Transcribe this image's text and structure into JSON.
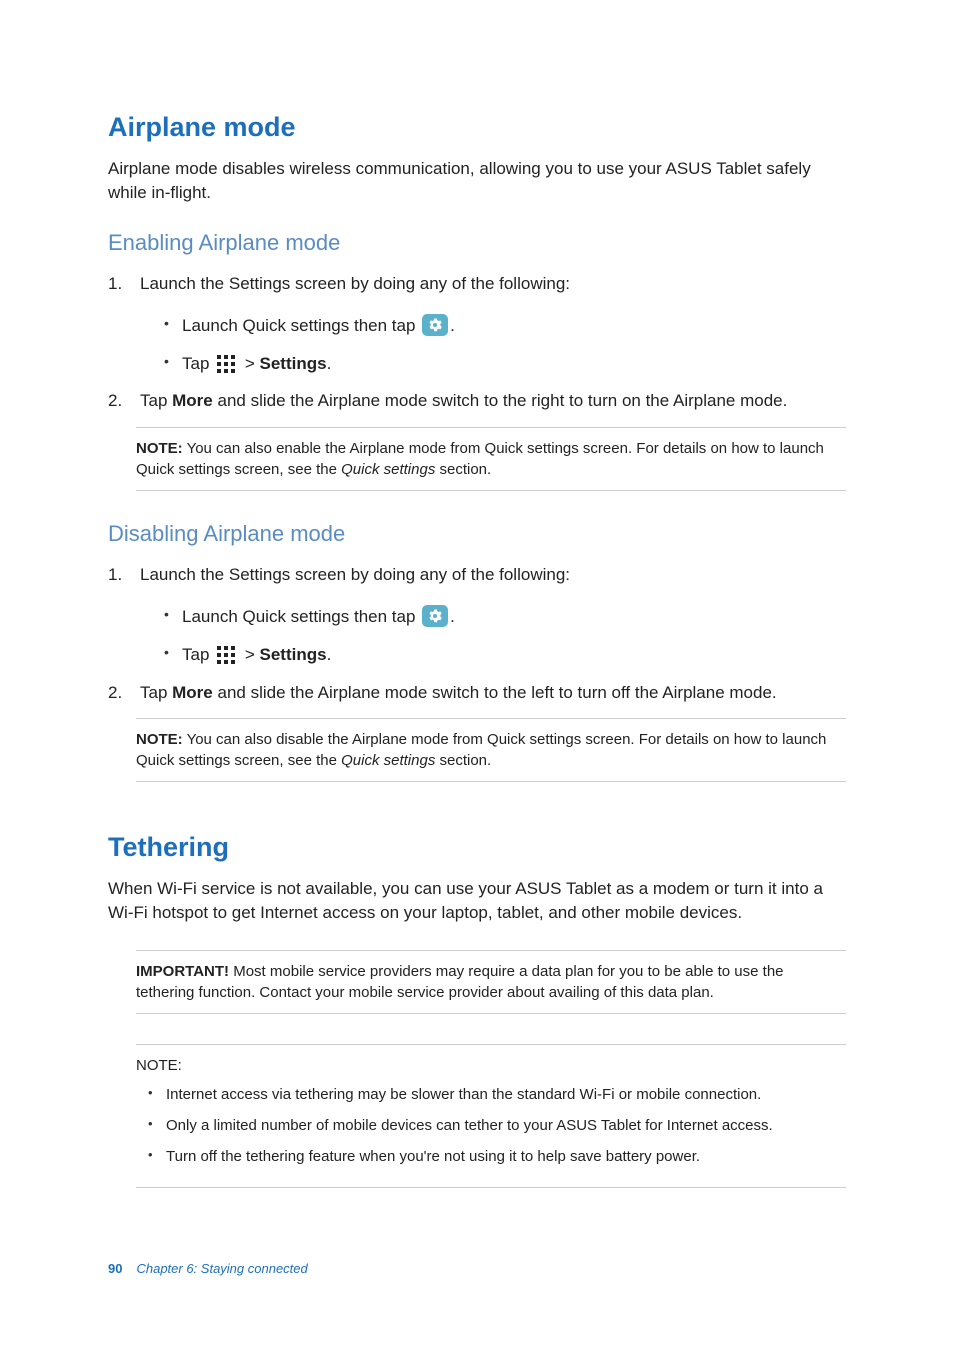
{
  "airplane": {
    "heading": "Airplane mode",
    "intro": "Airplane mode disables wireless communication, allowing you to use your ASUS Tablet safely while in-flight.",
    "enable": {
      "heading": "Enabling Airplane mode",
      "step1": "Launch the Settings screen by doing any of the following:",
      "sub1a": "Launch Quick settings then tap ",
      "sub1a_tail": ".",
      "sub1b_lead": "Tap ",
      "sub1b_mid": " > ",
      "sub1b_bold": "Settings",
      "sub1b_tail": ".",
      "step2_lead": "Tap ",
      "step2_bold": "More",
      "step2_tail": " and slide the Airplane mode switch to the right to turn on the Airplane mode.",
      "note_lead": "NOTE:",
      "note_body": " You can also enable the Airplane mode from Quick settings screen. For details on how to launch Quick settings screen, see the ",
      "note_ital": "Quick settings",
      "note_tail": " section."
    },
    "disable": {
      "heading": "Disabling Airplane mode",
      "step1": "Launch the Settings screen by doing any of the following:",
      "sub1a": "Launch Quick settings then tap ",
      "sub1a_tail": ".",
      "sub1b_lead": "Tap ",
      "sub1b_mid": " > ",
      "sub1b_bold": "Settings",
      "sub1b_tail": ".",
      "step2_lead": "Tap ",
      "step2_bold": "More",
      "step2_tail": " and slide the Airplane mode switch to the left to turn off the Airplane mode.",
      "note_lead": "NOTE:",
      "note_body": " You can also disable the Airplane mode from Quick settings screen. For details on how to launch Quick settings screen, see the ",
      "note_ital": "Quick settings",
      "note_tail": " section."
    }
  },
  "tethering": {
    "heading": "Tethering",
    "intro": "When Wi-Fi service is not available, you can use your ASUS Tablet as a modem or turn it into a Wi-Fi hotspot to get Internet access on your laptop, tablet, and other mobile devices.",
    "important_lead": "IMPORTANT!",
    "important_body": " Most mobile service providers may require a data plan for you to be able to use the tethering function. Contact your mobile service provider about availing of this data plan.",
    "note_lead": "NOTE:",
    "notes": {
      "0": "Internet access via tethering may be slower than the standard Wi-Fi or mobile connection.",
      "1": "Only a limited number of mobile devices can tether to your ASUS Tablet for Internet access.",
      "2": "Turn off the tethering feature when you're not using it to help save battery power."
    }
  },
  "footer": {
    "page": "90",
    "chapter": "Chapter 6: Staying connected"
  }
}
